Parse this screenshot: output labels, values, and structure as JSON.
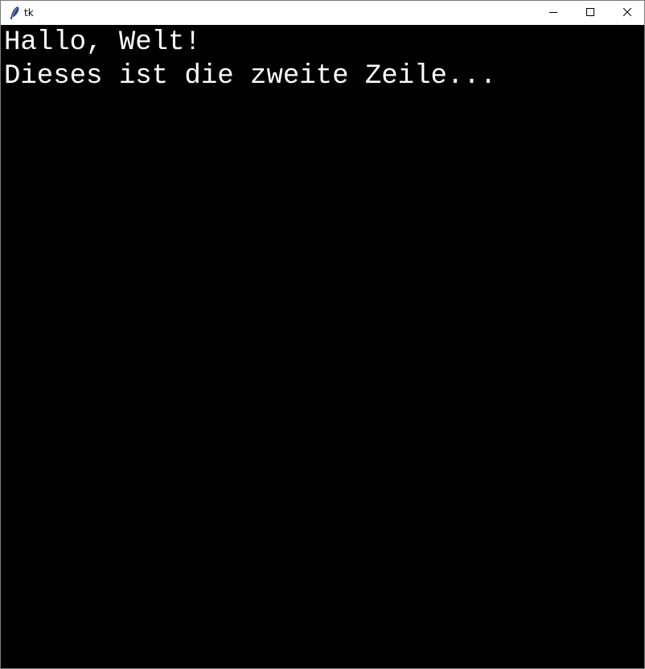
{
  "window": {
    "title": "tk",
    "icon": "tk-feather-icon",
    "controls": {
      "minimize_icon": "minimize-icon",
      "maximize_icon": "maximize-icon",
      "close_icon": "close-icon"
    }
  },
  "canvas": {
    "background": "#000000",
    "text_color": "#ffffff",
    "lines": [
      "Hallo, Welt!",
      "Dieses ist die zweite Zeile..."
    ]
  }
}
